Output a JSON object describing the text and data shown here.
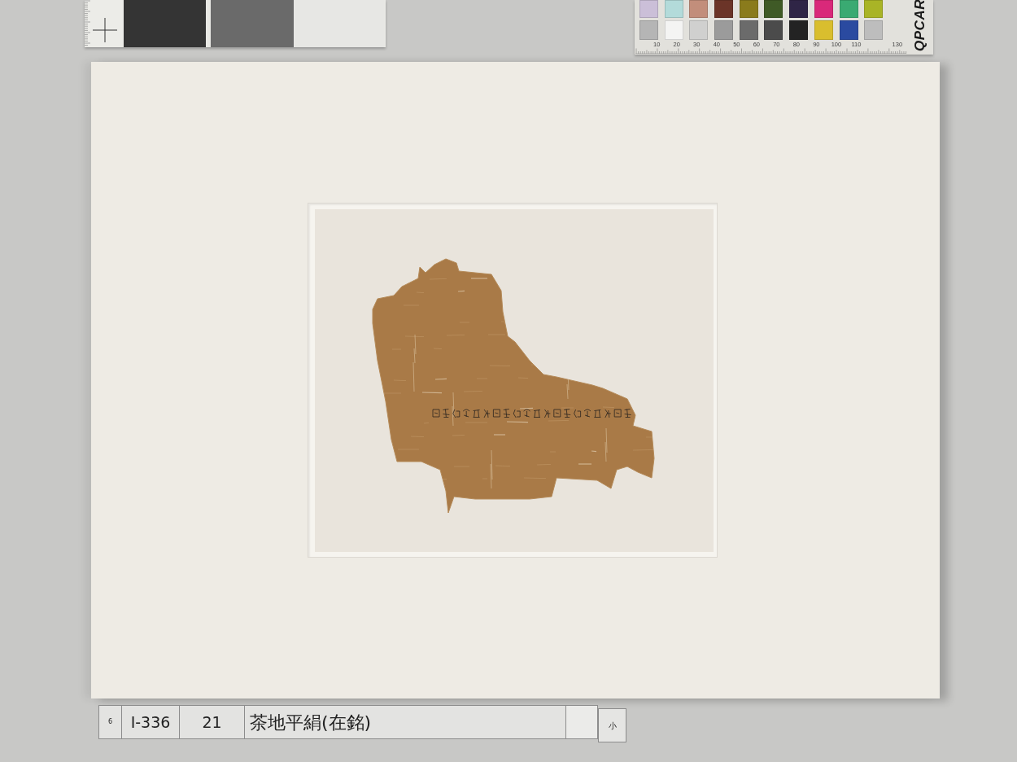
{
  "tone_card": {
    "swatches": [
      {
        "color": "#343434"
      },
      {
        "color": "#6a6a6a"
      },
      {
        "color": "#e7e7e4"
      }
    ]
  },
  "color_card": {
    "swatch_rows": [
      {
        "swatches": [
          {
            "color": "#cbbfd8"
          },
          {
            "color": "#b3dbda"
          },
          {
            "color": "#c28e7b"
          },
          {
            "color": "#6b3428"
          },
          {
            "color": "#8a7b1c"
          },
          {
            "color": "#3f5a26"
          },
          {
            "color": "#2f2546"
          },
          {
            "color": "#d9297a"
          },
          {
            "color": "#3aaa72"
          },
          {
            "color": "#a9b426"
          }
        ]
      },
      {
        "swatches": [
          {
            "color": "#b5b5b5"
          },
          {
            "color": "#f4f4f3"
          },
          {
            "color": "#d0d0cf"
          },
          {
            "color": "#9b9b9b"
          },
          {
            "color": "#6b6b6b"
          },
          {
            "color": "#4b4b4b"
          },
          {
            "color": "#232323"
          },
          {
            "color": "#d9be2e"
          },
          {
            "color": "#2a4aa0"
          },
          {
            "color": "#bdbdbd"
          }
        ]
      }
    ],
    "ruler_labels": [
      "10",
      "20",
      "30",
      "40",
      "50",
      "60",
      "70",
      "80",
      "90",
      "100",
      "110"
    ],
    "end_label": "130",
    "logo": "QPCAR"
  },
  "label_strip": {
    "cells": [
      {
        "kind": "index",
        "text": "6"
      },
      {
        "kind": "code",
        "text": "I-336"
      },
      {
        "kind": "number",
        "text": "21"
      },
      {
        "kind": "title",
        "text": "茶地平絹(在銘)"
      },
      {
        "kind": "blank"
      },
      {
        "kind": "size",
        "text": "小"
      }
    ]
  }
}
